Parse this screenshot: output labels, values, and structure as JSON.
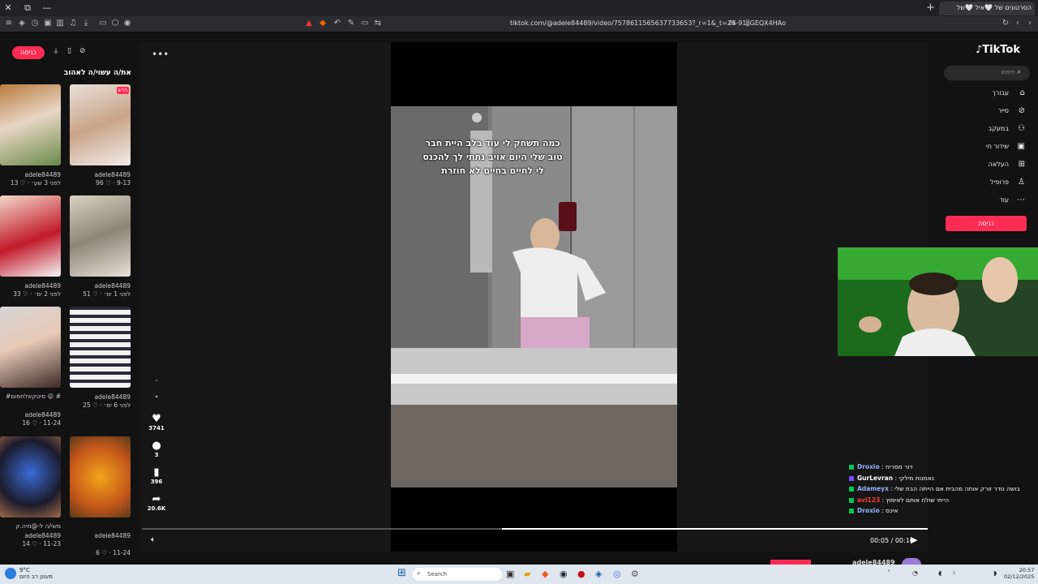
{
  "browser": {
    "active_tab_title": "הסרטונים של 🤍איל 🤍של",
    "new_tab": "+",
    "url": "tiktok.com/@adele84489/video/757861156563773365​3?_r=1&_t=ZS-91sGEQX4HAo"
  },
  "left_panel": {
    "login_label": "כניסה",
    "section_title": "את/ה עשוי/ה לאהוב",
    "badge_new": "חדש",
    "thumbs": [
      {
        "user": "adele84489",
        "meta": "13 ♡ · לפני 3 שע׳"
      },
      {
        "user": "adele84489",
        "meta": "96 ♡ · 9-13"
      },
      {
        "user": "adele84489",
        "meta": "33 ♡ · לפני 2 ימ׳"
      },
      {
        "user": "adele84489",
        "meta": "51 ♡ · לפני 1 ימ׳"
      },
      {
        "user": "adele84489",
        "meta": "16 ♡ · 11-24",
        "title": "#סיטקאלחסום 😜 #"
      },
      {
        "user": "adele84489",
        "meta": "25 ♡ · לפני 6 ימ׳"
      },
      {
        "user": "adele84489",
        "meta": "14 ♡ · 11-23",
        "title": "משי/ה ל-@מיה.ק"
      },
      {
        "user": "adele84489",
        "meta": "6 ♡ · 11-24"
      }
    ]
  },
  "video": {
    "caption": "כמה תשחק לי עוד בלב היית חבר טוב שלי היום אויב נתתי לך להכנס לי לחיים בחיים לא חוזרת",
    "time": "00:05 / 00:10"
  },
  "actions": {
    "likes": "3741",
    "comments": "3",
    "saves": "396",
    "shares": "20.6K"
  },
  "right_nav": {
    "logo": "TikTok",
    "search_placeholder": "חיפוש",
    "items": [
      "עבורך",
      "סייר",
      "במעקב",
      "שידור חי",
      "העלאה",
      "פרופיל",
      "עוד"
    ],
    "login": "כניסה"
  },
  "chat": [
    {
      "user": "Droxio",
      "msg": "דור מסריח",
      "color": "#8fb3ff"
    },
    {
      "user": "GurLevran",
      "msg": "נאמנות מילקי",
      "color": "#ffffff"
    },
    {
      "user": "Adameyx",
      "msg": "בושה נודר זורק אותה מהבית אם הייתה הבת שלי",
      "color": "#8fb3ff"
    },
    {
      "user": "avi123",
      "msg": "הייתי שולח אותם לאימוץ",
      "color": "#ff3b3b"
    },
    {
      "user": "Droxio",
      "msg": "איכס",
      "color": "#8fb3ff"
    }
  ],
  "taskbar": {
    "weather_temp": "9°C",
    "weather_desc": "מעונן רב היום",
    "search": "Search",
    "time": "20:57",
    "date": "02/12/2025"
  },
  "bottom_user": "adele84489"
}
